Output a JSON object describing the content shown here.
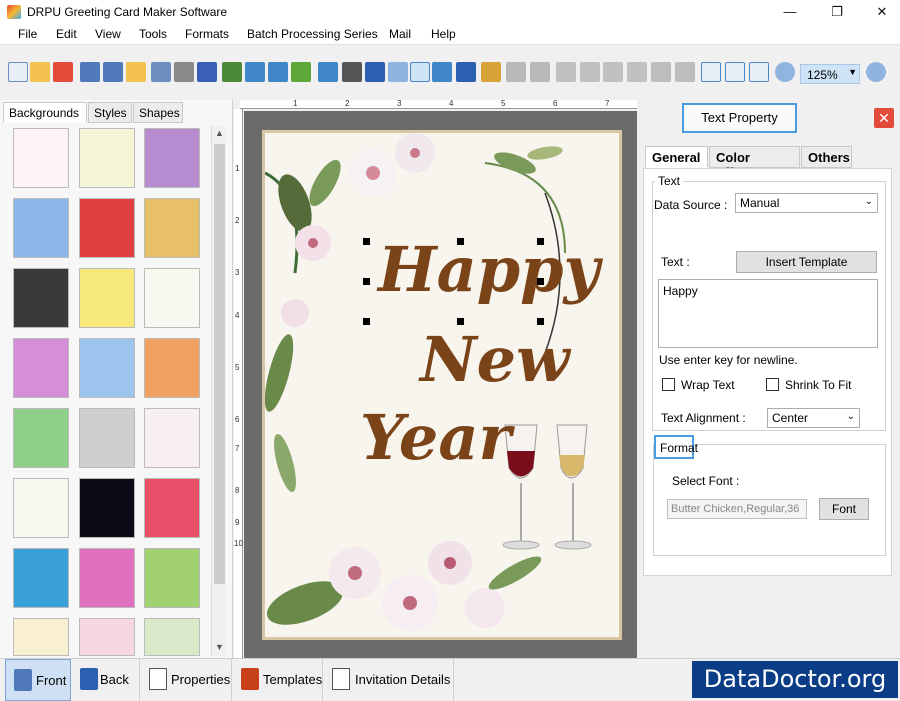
{
  "window": {
    "title": "DRPU Greeting Card Maker Software",
    "controls": [
      "—",
      "❐",
      "✕"
    ]
  },
  "menu": [
    "File",
    "Edit",
    "View",
    "Tools",
    "Formats",
    "Batch Processing Series",
    "Mail",
    "Help"
  ],
  "toolbar": {
    "zoom_value": "125%"
  },
  "left_panel": {
    "tabs": [
      "Backgrounds",
      "Styles",
      "Shapes"
    ],
    "active_tab": "Backgrounds"
  },
  "ruler": {
    "h_ticks": [
      "1",
      "2",
      "3",
      "4",
      "5",
      "6",
      "7"
    ],
    "v_ticks": [
      "1",
      "2",
      "3",
      "4",
      "5",
      "6",
      "7",
      "8",
      "9",
      "10"
    ]
  },
  "card": {
    "line1": "Happy",
    "line2": "New",
    "line3": "Year"
  },
  "right_panel": {
    "header": "Text Property",
    "close_symbol": "✕",
    "tabs": [
      "General",
      "Color Effects",
      "Others"
    ],
    "active_tab": "General",
    "text_group": "Text",
    "data_source_label": "Data Source :",
    "data_source_value": "Manual",
    "text_label": "Text :",
    "insert_template": "Insert Template",
    "text_value": "Happy",
    "newline_hint": "Use enter key for newline.",
    "wrap_text": "Wrap Text",
    "shrink_to_fit": "Shrink To Fit",
    "alignment_label": "Text Alignment :",
    "alignment_value": "Center",
    "format_group": "Format",
    "select_font_label": "Select Font :",
    "font_value": "Butter Chicken,Regular,36",
    "font_button": "Font"
  },
  "bottom_bar": {
    "front": "Front",
    "back": "Back",
    "properties": "Properties",
    "templates": "Templates",
    "invitation": "Invitation Details"
  },
  "brand": "DataDoctor.org"
}
